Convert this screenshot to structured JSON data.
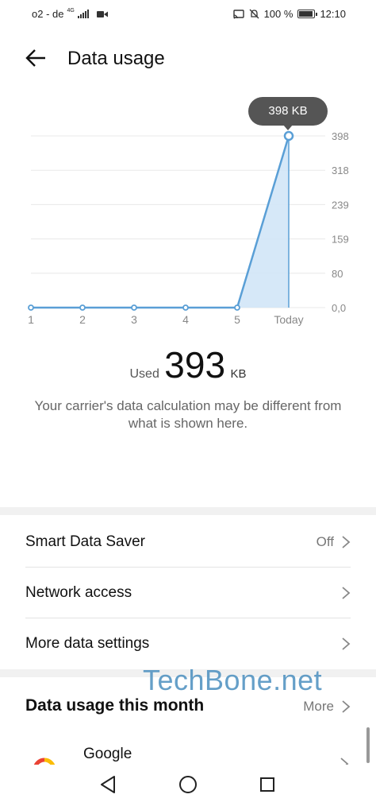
{
  "status_bar": {
    "carrier": "o2 - de",
    "network_type": "4G",
    "battery": "100 %",
    "battery_level": 1.0,
    "time": "12:10"
  },
  "header": {
    "title": "Data usage",
    "back_icon": "arrow-left-icon"
  },
  "chart_data": {
    "type": "area",
    "categories": [
      "1",
      "2",
      "3",
      "4",
      "5",
      "Today"
    ],
    "values": [
      0,
      0,
      0,
      0,
      0,
      398
    ],
    "unit": "KB",
    "y_ticks": [
      "0,0",
      "80",
      "159",
      "239",
      "318",
      "398"
    ],
    "ylim": [
      0,
      398
    ],
    "tooltip": "398 KB",
    "grid": true,
    "colors": {
      "line": "#5a9fd6",
      "fill": "#cfe4f7",
      "grid": "#e8e8e8"
    }
  },
  "usage": {
    "label": "Used",
    "value": "393",
    "unit": "KB"
  },
  "note": "Your carrier's data calculation may be different from what is shown here.",
  "settings": [
    {
      "label": "Smart Data Saver",
      "value": "Off"
    },
    {
      "label": "Network access",
      "value": ""
    },
    {
      "label": "More data settings",
      "value": ""
    }
  ],
  "month_section": {
    "title": "Data usage this month",
    "more": "More"
  },
  "apps": [
    {
      "name": "Google",
      "icon": "google-icon"
    }
  ],
  "watermark": "TechBone.net",
  "nav_bar": {
    "back_icon": "triangle-back-icon",
    "home_icon": "circle-home-icon",
    "recents_icon": "square-recents-icon"
  }
}
